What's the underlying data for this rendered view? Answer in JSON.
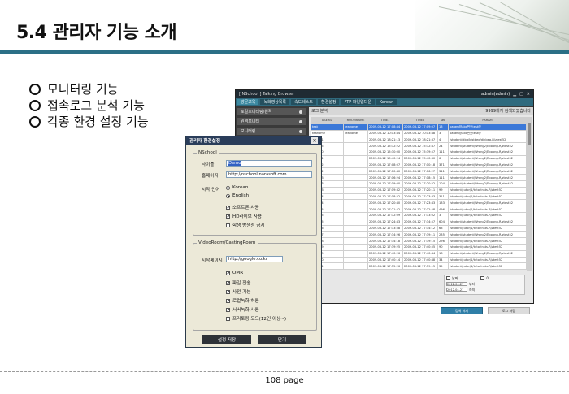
{
  "slide": {
    "title": "5.4 관리자 기능 소개",
    "bullets": [
      "모니터링 기능",
      "접속로그 분석 기능",
      "각종 환경 설정 기능"
    ],
    "page": "108 page"
  },
  "app": {
    "title": "[ NSchool ]   Talking Browser",
    "user": "admin(admin)",
    "nav": [
      "방문교육",
      "녹화영상목록",
      "속도테스트",
      "환경설정",
      "FTP 파일업다운",
      "Korean"
    ],
    "sidebar": [
      "로컬모니터링/원격",
      "원격모니터",
      "모니터링",
      "",
      ""
    ],
    "log_panel": {
      "title": "로그 분석",
      "count": "9999개가 검색되었습니다",
      "columns": [
        "USERID",
        "ROOMNAME",
        "TIME1",
        "TIME2",
        "sec",
        "PARAM"
      ],
      "rows": [
        [
          "test",
          "teahome",
          "2009-03-12 17:08:44",
          "2009-03-12 17:09:07",
          "13",
          "param@abc번호test@"
        ],
        [
          "teahome",
          "teahome",
          "2009-03-12 10:13:44",
          "2009-03-12 10:13:48",
          "3",
          "param@abc번호test@"
        ],
        [
          "090411",
          "",
          "2009-03-12 18:21:13",
          "2009-03-12 18:21:37",
          "4",
          "/student/dbg/bistbeg/dinbeg-R/ztest52"
        ],
        [
          "090415",
          "",
          "2009-03-12 15:32:22",
          "2009-03-12 15:32:47",
          "24",
          "/student/student/Wrong2/Eboong-R/ztest52"
        ],
        [
          "090420",
          "",
          "2009-03-12 15:30:00",
          "2009-03-12 15:39:57",
          "111",
          "/student/student/Wrong2/Eboong-R/ztest52"
        ],
        [
          "090421",
          "",
          "2009-03-12 15:40:24",
          "2009-03-12 15:40:30",
          "6",
          "/student/student/Wrong2/Eboong-R/ztest52"
        ],
        [
          "090422",
          "",
          "2009-03-12 17:08:07",
          "2009-03-12 17:10:18",
          "371",
          "/student/student/Wrong2/Eboong-R/ztest52"
        ],
        [
          "090422",
          "",
          "2009-03-12 17:10:40",
          "2009-03-12 17:16:27",
          "341",
          "/student/student/Wrong2/Eboong-R/ztest52"
        ],
        [
          "090423",
          "",
          "2009-03-12 17:16:24",
          "2009-03-12 17:18:15",
          "111",
          "/student/student/Wrong2/Eboong-R/ztest52"
        ],
        [
          "090423",
          "",
          "2009-03-12 17:19:00",
          "2009-03-12 17:20:22",
          "104",
          "/student/student/Wrong2/Eboong-R/ztest52"
        ],
        [
          "090423",
          "",
          "2009-03-12 17:19:32",
          "2009-03-12 17:20:11",
          "99",
          "/student/tutor/1/tutorInsts-R/ztest52"
        ],
        [
          "090424",
          "",
          "2009-03-12 17:18:22",
          "2009-03-12 17:23:33",
          "311",
          "/student/tutor/1/tutorInsts-R/ztest52"
        ],
        [
          "090424",
          "",
          "2009-03-12 17:20:40",
          "2009-03-12 17:23:43",
          "183",
          "/student/student/Wrong2/Eboong-R/ztest52"
        ],
        [
          "090425",
          "",
          "2009-03-12 17:21:52",
          "2009-03-12 17:32:58",
          "496",
          "/student/tutor/1/tutorInsts-R/ztest52"
        ],
        [
          "090425",
          "",
          "2009-03-12 17:32:09",
          "2009-03-12 17:33:02",
          "3",
          "/student/tutor/1/tutorInsts-R/ztest52"
        ],
        [
          "090425",
          "",
          "2009-03-12 17:24:43",
          "2009-03-12 17:34:57",
          "604",
          "/student/student/Wrong2/Eboong-R/ztest52"
        ],
        [
          "090426",
          "",
          "2009-03-12 17:33:58",
          "2009-03-12 17:34:12",
          "63",
          "/student/tutor/1/tutorInsts-R/ztest52"
        ],
        [
          "090427",
          "",
          "2009-03-12 17:34:26",
          "2009-03-12 17:39:11",
          "285",
          "/student/student/Wrong2/Eboong-R/ztest52"
        ],
        [
          "090428",
          "",
          "2009-03-12 17:34:18",
          "2009-03-12 17:39:15",
          "296",
          "/student/tutor/1/tutorInsts-R/ztest52"
        ],
        [
          "090429",
          "",
          "2009-03-12 17:39:25",
          "2009-03-12 17:40:55",
          "90",
          "/student/tutor/1/tutorInsts-R/ztest52"
        ],
        [
          "090429",
          "",
          "2009-03-12 17:40:26",
          "2009-03-12 17:40:44",
          "18",
          "/student/student/Wrong2/Eboong-R/ztest52"
        ],
        [
          "090430",
          "",
          "2009-03-12 17:40:14",
          "2009-03-12 17:40:48",
          "34",
          "/student/tutor/1/tutorInsts-R/ztest52"
        ],
        [
          "090431",
          "",
          "2009-03-12 17:55:26",
          "2009-03-12 17:59:15",
          "35",
          "/student/tutor/1/tutorInsts-R/ztest52"
        ]
      ]
    },
    "filter": {
      "date_label": "날짜",
      "date_from": "2012-04-27",
      "date_to": "2012-04-27",
      "from_suffix": "부터",
      "to_suffix": "까지",
      "id_value": "0"
    },
    "buttons": [
      "검색 하기",
      "로그 저장"
    ]
  },
  "dialog": {
    "title": "관리자 환경설정",
    "group1": "NSchool",
    "title_label": "타이틀",
    "title_value": "Demo",
    "home_label": "홈페이지",
    "home_value": "http://nschool.narasoft.com",
    "lang_label": "시작 언어",
    "lang_options": [
      "Korean",
      "English"
    ],
    "lang_selected": 1,
    "checks1": [
      {
        "label": "소프트폰 사용",
        "checked": true
      },
      {
        "label": "HD라이브 사용",
        "checked": true
      },
      {
        "label": "학생 방생성 금지",
        "checked": false
      }
    ],
    "group2": "VideoRoom/CastingRoom",
    "start_label": "시작페이지",
    "start_value": "http://google.co.kr",
    "checks2": [
      {
        "label": "OMR",
        "checked": true
      },
      {
        "label": "파일 전송",
        "checked": true
      },
      {
        "label": "사전 기능",
        "checked": true
      },
      {
        "label": "로컬녹화 허용",
        "checked": true
      },
      {
        "label": "서버녹화 사용",
        "checked": true
      },
      {
        "label": "프리토킹 모드(12인 이상~)",
        "checked": false
      }
    ],
    "save_label": "설정 저장",
    "close_label": "닫기",
    "check_mark": "✔",
    "close_glyph": "✕"
  }
}
